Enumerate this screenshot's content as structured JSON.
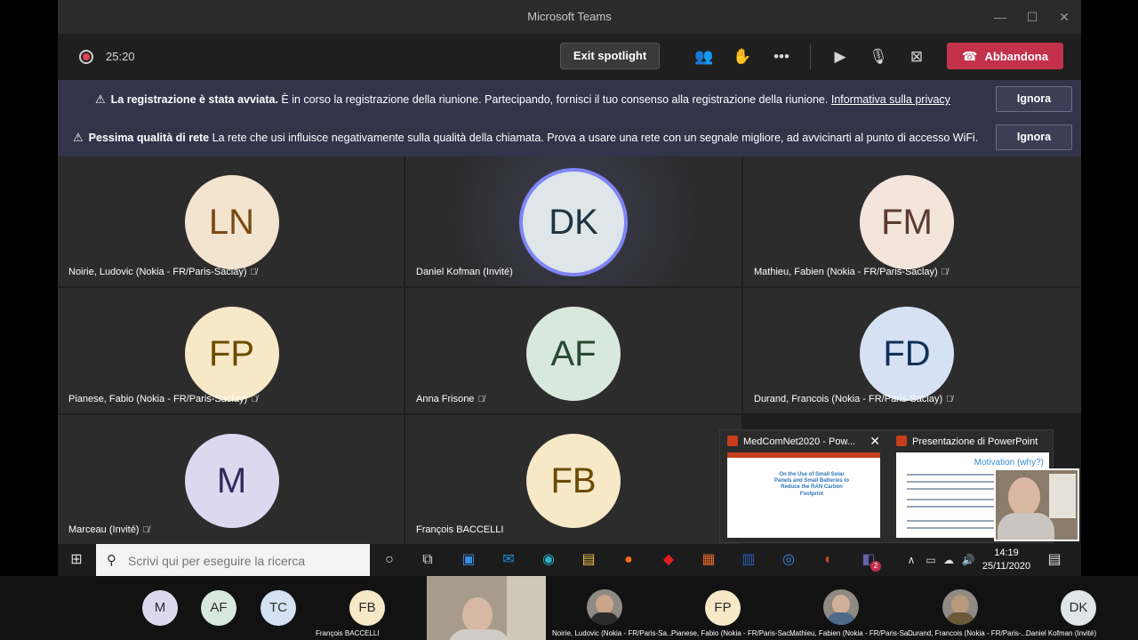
{
  "window": {
    "title": "Microsoft Teams"
  },
  "toolbar": {
    "timer": "25:20",
    "exit_spotlight": "Exit spotlight",
    "leave": "Abbandona"
  },
  "banners": [
    {
      "bold": "La registrazione è stata avviata.",
      "text": "È in corso la registrazione della riunione. Partecipando, fornisci il tuo consenso alla registrazione della riunione.",
      "link": "Informativa sulla privacy",
      "button": "Ignora"
    },
    {
      "bold": "Pessima qualità di rete",
      "text": "La rete che usi influisce negativamente sulla qualità della chiamata. Prova a usare una rete con un segnale migliore, ad avvicinarti al punto di accesso WiFi.",
      "button": "Ignora"
    }
  ],
  "tiles": [
    {
      "initials": "LN",
      "name": "Noirie, Ludovic (Nokia - FR/Paris-Saclay)",
      "bg": "#f3e4cf",
      "fg": "#7a4a16",
      "muted": true
    },
    {
      "initials": "DK",
      "name": "Daniel Kofman (Invité)",
      "bg": "#dfe6ea",
      "fg": "#1f3340",
      "muted": false,
      "speaking": true
    },
    {
      "initials": "FM",
      "name": "Mathieu, Fabien (Nokia - FR/Paris-Saclay)",
      "bg": "#f3e4dc",
      "fg": "#5b3a2e",
      "muted": true
    },
    {
      "initials": "FP",
      "name": "Pianese, Fabio (Nokia - FR/Paris-Saclay)",
      "bg": "#f7e9c8",
      "fg": "#6b4b00",
      "muted": true
    },
    {
      "initials": "AF",
      "name": "Anna Frisone",
      "bg": "#d9e8dc",
      "fg": "#264b32",
      "muted": true
    },
    {
      "initials": "FD",
      "name": "Durand, Francois (Nokia - FR/Paris-Saclay)",
      "bg": "#d6e2f3",
      "fg": "#12305a",
      "muted": true
    },
    {
      "initials": "M",
      "name": "Marceau (Invité)",
      "bg": "#dcd8ef",
      "fg": "#2e2a5a",
      "muted": true
    },
    {
      "initials": "FB",
      "name": "François BACCELLI",
      "bg": "#f7e9c8",
      "fg": "#6b4b00",
      "muted": false
    }
  ],
  "thumbnails": [
    {
      "title": "MedComNet2020 - Pow...",
      "slide_title": "On the Use of Small Solar Panels and Small Batteries to Reduce the RAN Carbon Footprint"
    },
    {
      "title": "Presentazione di PowerPoint ...",
      "slide_title": "Motivation (why?)"
    }
  ],
  "taskbar": {
    "search_placeholder": "Scrivi qui per eseguire la ricerca",
    "time": "14:19",
    "date": "25/11/2020",
    "teams_badge": "2"
  },
  "strip": [
    {
      "initials": "M",
      "bg": "#dcd8ef"
    },
    {
      "initials": "AF",
      "bg": "#d9e8dc"
    },
    {
      "initials": "TC",
      "bg": "#d6e2f3"
    },
    {
      "initials": "FB",
      "bg": "#f7e9c8",
      "name": "François BACCELLI"
    },
    {
      "name": "Noirie, Ludovic (Nokia - FR/Paris-Sa..."
    },
    {
      "initials": "FP",
      "bg": "#f7e9c8",
      "name": "Pianese, Fabio (Nokia - FR/Paris-Sac..."
    },
    {
      "name": "Mathieu, Fabien (Nokia - FR/Paris-Sa..."
    },
    {
      "name": "Durand, Francois (Nokia - FR/Paris-..."
    },
    {
      "initials": "DK",
      "bg": "#dfe6ea",
      "name": "Daniel Kofman (Invité)"
    }
  ]
}
